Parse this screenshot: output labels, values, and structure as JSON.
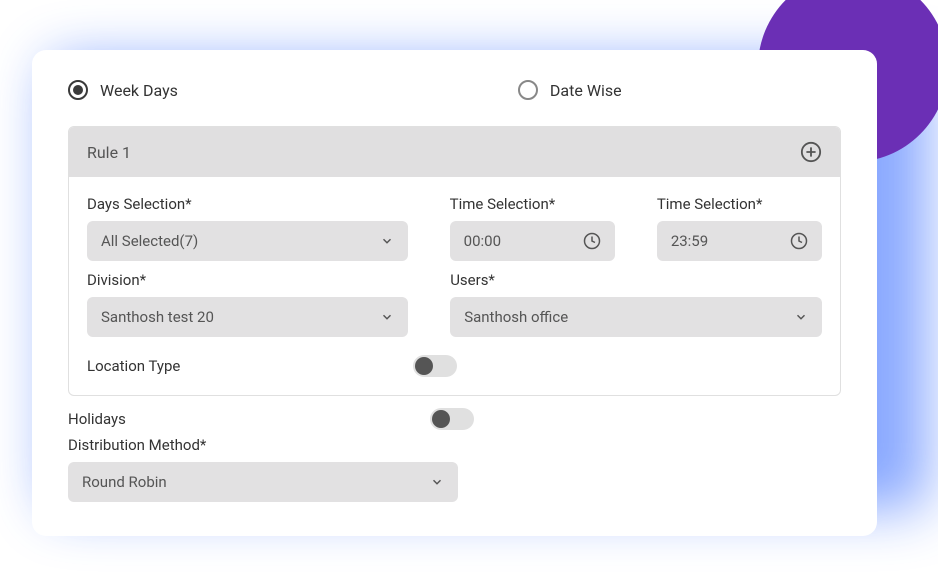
{
  "tabs": {
    "week_days": "Week Days",
    "date_wise": "Date Wise"
  },
  "rule": {
    "title": "Rule 1",
    "days_selection": {
      "label": "Days Selection*",
      "value": "All Selected(7)"
    },
    "time_start": {
      "label": "Time Selection*",
      "value": "00:00"
    },
    "time_end": {
      "label": "Time Selection*",
      "value": "23:59"
    },
    "division": {
      "label": "Division*",
      "value": "Santhosh test 20"
    },
    "users": {
      "label": "Users*",
      "value": "Santhosh office"
    },
    "location_type": {
      "label": "Location Type"
    }
  },
  "holidays": {
    "label": "Holidays"
  },
  "distribution": {
    "label": "Distribution Method*",
    "value": "Round Robin"
  }
}
